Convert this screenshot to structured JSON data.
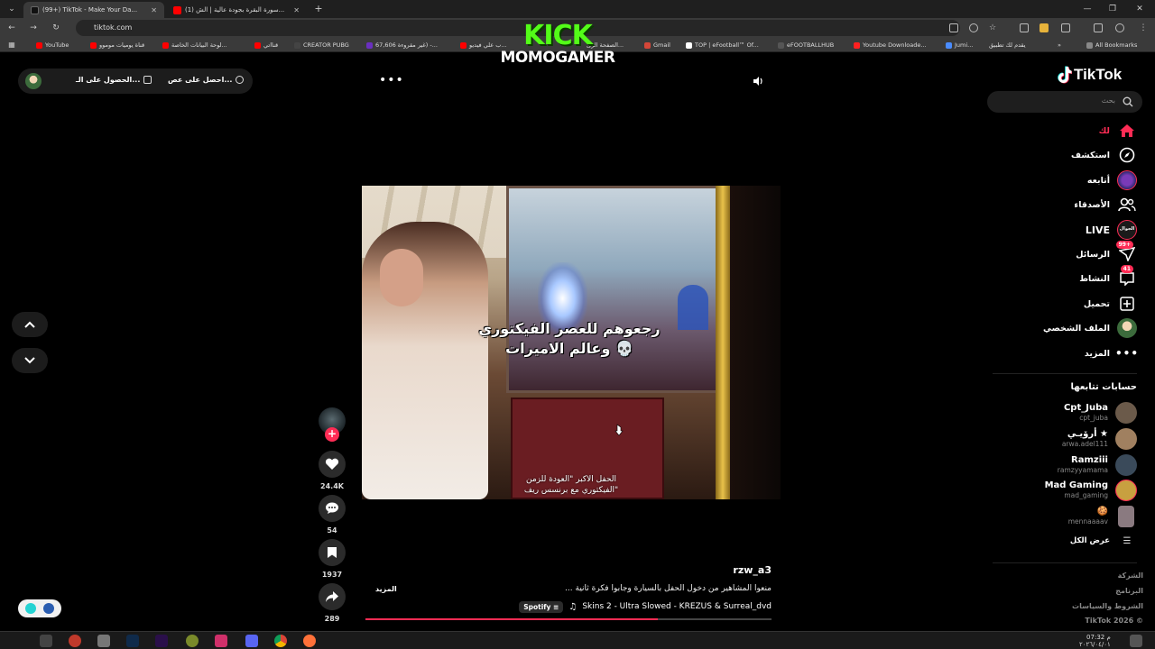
{
  "browser": {
    "tabs": [
      {
        "title": "(99+) TikTok - Make Your Da...",
        "active": true,
        "favicon_color": "#111111"
      },
      {
        "title": "(1) سورة البقرة بجودة عالية | الش...",
        "active": false,
        "favicon_color": "#ff0000"
      }
    ],
    "url": "tiktok.com",
    "bookmarks": [
      {
        "label": "YouTube",
        "color": "#ff0000"
      },
      {
        "label": "قناة يوميات موموو",
        "color": "#ff0000"
      },
      {
        "label": "لوحة البيانات الخاصة...",
        "color": "#ff0000"
      },
      {
        "label": "قنااتي",
        "color": "#ff0000"
      },
      {
        "label": "CREATOR PUBG",
        "color": "#2b2b2b"
      },
      {
        "label": "67,606 غير مقروءة) -...",
        "color": "#6a2fbf"
      },
      {
        "label": "ب علي فيديو...",
        "color": "#ff0000"
      },
      {
        "label": "الصفحة الرئ...",
        "color": "#e0a030"
      },
      {
        "label": "Gmail",
        "color": "#d44638"
      },
      {
        "label": "TOP | eFootball™ Of...",
        "color": "#ffffff"
      },
      {
        "label": "eFOOTBALLHUB",
        "color": "#222222"
      },
      {
        "label": "Youtube Downloade...",
        "color": "#ff2020"
      },
      {
        "label": "Jumi...",
        "color": "#4a8cff"
      },
      {
        "label": "يقدم لك تطبيق",
        "color": "#888888"
      },
      {
        "label": "All Bookmarks",
        "color": "#888888"
      }
    ]
  },
  "overlay": {
    "kick_text": "KICK",
    "channel_text": "MOMOGAMER",
    "kick_color": "#53fc18"
  },
  "topbar": {
    "get_app_label": "احصل على عص...",
    "get_desktop_label": "الحصول على الـ..."
  },
  "video": {
    "caption_line1": "رجعوهم للعصر الفيكتوري",
    "caption_line2": "وعالم الاميرات 💀",
    "subtitle_line1": "الحفل الاكبر \"العودة للزمن",
    "subtitle_line2": "الفيكتوري مع برنسس ريف\"",
    "progress": 0.72
  },
  "actions": {
    "likes": "24.4K",
    "comments": "54",
    "saves": "1937",
    "shares": "289"
  },
  "post": {
    "username": "rzw_a3",
    "description": "منعوا المشاهير من دخول الحفل بالسيارة وجابوا فكرة ثانية ...",
    "more_label": "المزيد",
    "music_title": "Skins 2 - Ultra Slowed - KREZUS & Surreal_dvd",
    "spotify_label": "Spotify"
  },
  "sidebar": {
    "logo_text": "TikTok",
    "search_placeholder": "بحث",
    "nav": [
      {
        "label": "لك",
        "icon": "home-icon",
        "active": true
      },
      {
        "label": "استكشف",
        "icon": "compass-icon",
        "active": false
      },
      {
        "label": "أتابعه",
        "icon": "following-avatar-icon",
        "active": false
      },
      {
        "label": "الأصدقاء",
        "icon": "friends-icon",
        "active": false
      },
      {
        "label": "LIVE",
        "icon": "live-icon",
        "active": false
      },
      {
        "label": "الرسائل",
        "icon": "messages-icon",
        "active": false,
        "badge": "99+"
      },
      {
        "label": "النشاط",
        "icon": "activity-icon",
        "active": false,
        "badge": "41"
      },
      {
        "label": "تحميل",
        "icon": "upload-icon",
        "active": false
      },
      {
        "label": "الملف الشخصي",
        "icon": "profile-avatar-icon",
        "active": false
      },
      {
        "label": "المزيد",
        "icon": "more-dots-icon",
        "active": false
      }
    ],
    "live_badge_text": "الجوال",
    "following_header": "حسابات تتابعها",
    "following": [
      {
        "name": "Cpt_Juba",
        "handle": "cpt_juba",
        "avatar_color": "#6b5a4a"
      },
      {
        "name": "أرۆيـي ★",
        "handle": "arwa.adel111",
        "avatar_color": "#a08060"
      },
      {
        "name": "Ramziii",
        "handle": "ramzyyamama",
        "avatar_color": "#3a4a5a"
      },
      {
        "name": "Mad Gaming",
        "handle": "mad_gaming",
        "avatar_color": "#c8a040"
      },
      {
        "name": "🍪",
        "handle": "mennaaaav",
        "avatar_color": "#8a7a80"
      }
    ],
    "see_all_label": "عرض الكل",
    "footer": [
      "الشركة",
      "البرنامج",
      "الشروط والسياسات",
      "TikTok 2026 ©"
    ]
  },
  "taskbar": {
    "time": "07:32 م",
    "date": "٢٠٢٦/٠٤/٠١"
  }
}
